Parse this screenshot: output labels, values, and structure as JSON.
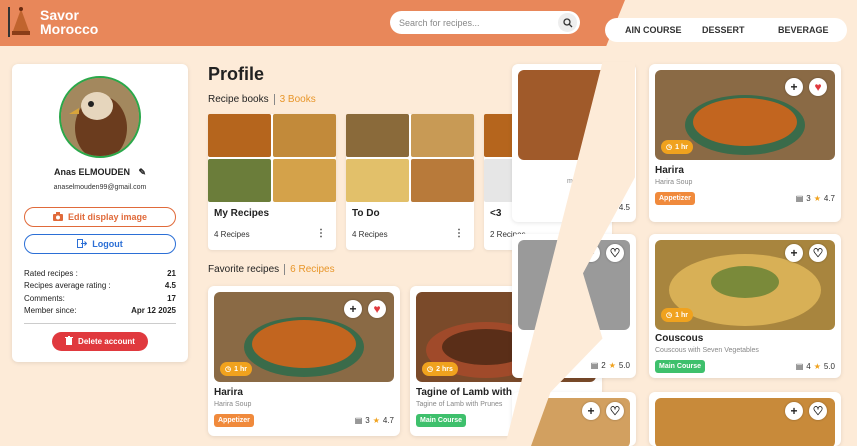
{
  "header": {
    "logo_line1": "Savor",
    "logo_line2": "Morocco",
    "search_placeholder": "Search for recipes...",
    "nav": [
      "AIN COURSE",
      "DESSERT",
      "BEVERAGE"
    ],
    "brand_color": "#e8875a"
  },
  "profile": {
    "name": "Anas ELMOUDEN",
    "email": "anaselmouden99@gmail.com",
    "edit_image_label": "Edit display image",
    "logout_label": "Logout",
    "stats": [
      {
        "label": "Rated recipes :",
        "value": "21"
      },
      {
        "label": "Recipes average rating :",
        "value": "4.5"
      },
      {
        "label": "Comments:",
        "value": "17"
      },
      {
        "label": "Member since:",
        "value": "Apr 12 2025"
      }
    ],
    "delete_label": "Delete account"
  },
  "main": {
    "title": "Profile",
    "recipe_books_label": "Recipe books",
    "recipe_books_count": "3 Books",
    "favorites_label": "Favorite recipes",
    "favorites_count": "6 Recipes"
  },
  "books": [
    {
      "name": "My Recipes",
      "count": "4 Recipes"
    },
    {
      "name": "To Do",
      "count": "4 Recipes"
    },
    {
      "name": "<3",
      "count": "2 Recipes"
    }
  ],
  "favorites": [
    {
      "title": "Harira",
      "subtitle": "Harira Soup",
      "time": "1 hr",
      "tag": "Appetizer",
      "comments": "3",
      "rating": "4.7"
    },
    {
      "title": "Tagine of Lamb with",
      "subtitle": "Tagine of Lamb with Prunes",
      "time": "2 hrs",
      "tag": "Main Course"
    }
  ],
  "side_cards": [
    {
      "subtitle": "mons and",
      "comments": "3",
      "rating": "4.5"
    },
    {
      "comments": "2",
      "rating": "5.0"
    }
  ],
  "right_cards": [
    {
      "title": "Harira",
      "subtitle": "Harira Soup",
      "time": "1 hr",
      "tag": "Appetizer",
      "comments": "3",
      "rating": "4.7"
    },
    {
      "title": "Couscous",
      "subtitle": "Couscous with Seven Vegetables",
      "time": "1 hr",
      "tag": "Main Course",
      "comments": "4",
      "rating": "5.0"
    }
  ]
}
